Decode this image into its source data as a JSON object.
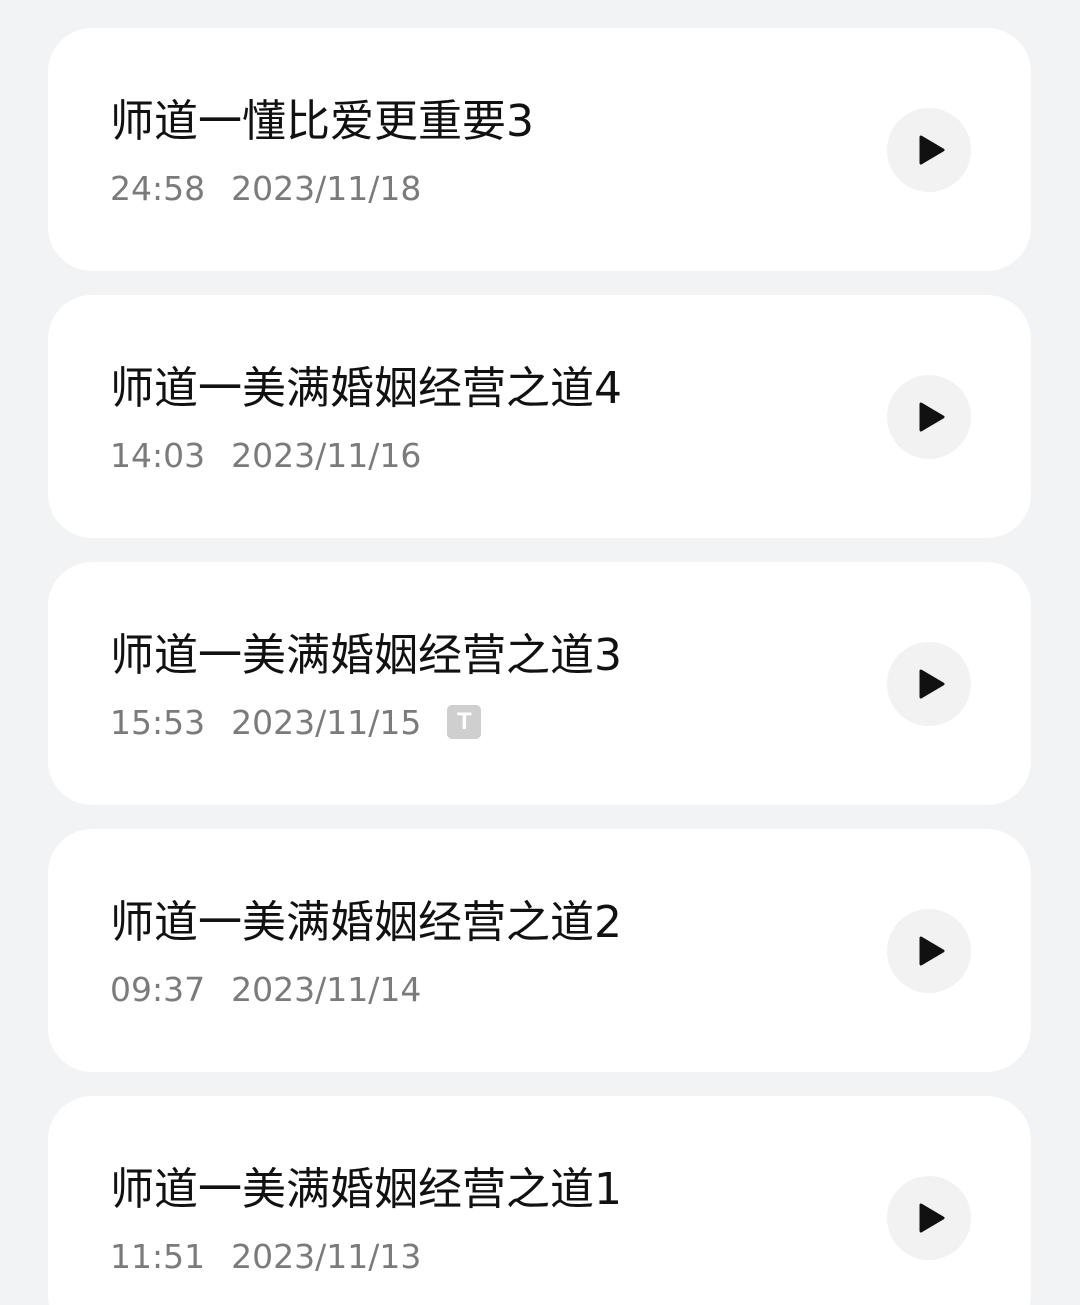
{
  "recordings": [
    {
      "title": "师道一懂比爱更重要3",
      "duration": "24:58",
      "date": "2023/11/18",
      "has_transcript": false
    },
    {
      "title": "师道一美满婚姻经营之道4",
      "duration": "14:03",
      "date": "2023/11/16",
      "has_transcript": false
    },
    {
      "title": "师道一美满婚姻经营之道3",
      "duration": "15:53",
      "date": "2023/11/15",
      "has_transcript": true,
      "transcript_badge": "T"
    },
    {
      "title": "师道一美满婚姻经营之道2",
      "duration": "09:37",
      "date": "2023/11/14",
      "has_transcript": false
    },
    {
      "title": "师道一美满婚姻经营之道1",
      "duration": "11:51",
      "date": "2023/11/13",
      "has_transcript": false
    }
  ],
  "icons": {
    "play": "play-icon",
    "transcript": "transcript-icon"
  },
  "colors": {
    "background": "#f2f3f5",
    "card": "#ffffff",
    "title": "#111111",
    "meta": "#7b7b7b",
    "play_button_bg": "#f2f2f2"
  }
}
